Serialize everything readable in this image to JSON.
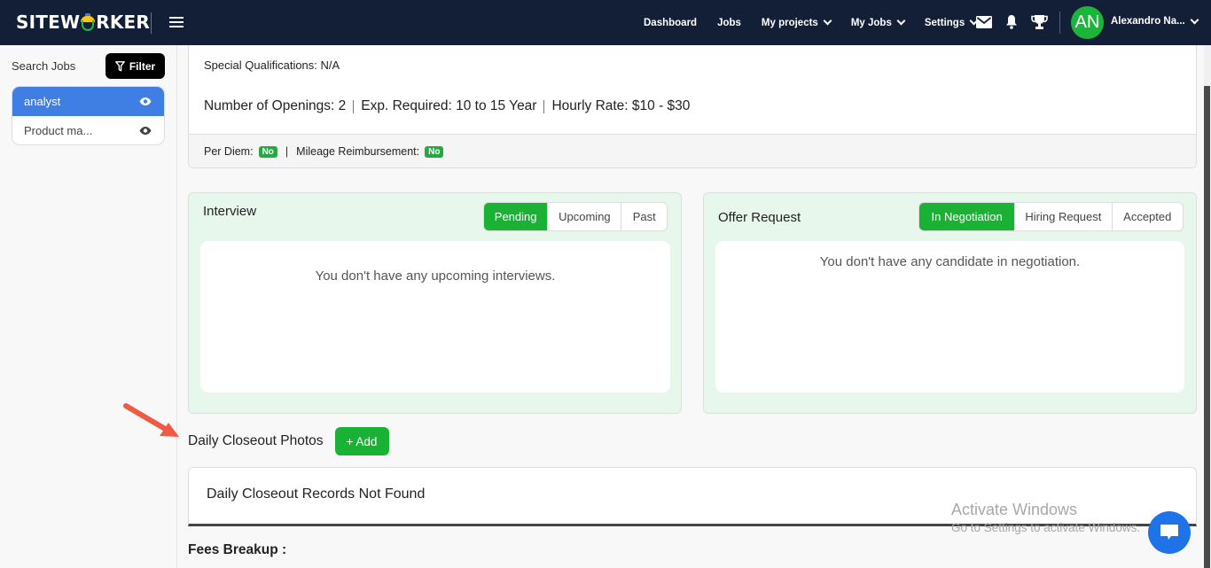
{
  "header": {
    "logo": "SITEWORKER",
    "logo_parts": {
      "before": "SITEW",
      "after": "RKER"
    },
    "nav": [
      {
        "label": "Dashboard",
        "has_dropdown": false
      },
      {
        "label": "Jobs",
        "has_dropdown": false
      },
      {
        "label": "My projects",
        "has_dropdown": true
      },
      {
        "label": "My Jobs",
        "has_dropdown": true
      },
      {
        "label": "Settings",
        "has_dropdown": true
      }
    ],
    "icons": [
      "mail-icon",
      "bell-icon",
      "trophy-icon"
    ],
    "user": {
      "initials": "AN",
      "name": "Alexandro Na...",
      "avatar_color": "#1cb53c"
    }
  },
  "sidebar": {
    "search_label": "Search Jobs",
    "filter_label": "Filter",
    "jobs": [
      {
        "title": "analyst",
        "active": true
      },
      {
        "title": "Product ma...",
        "active": false
      }
    ]
  },
  "details": {
    "special_label": "Special Qualifications:",
    "special_value": "N/A",
    "openings": "Number of Openings: 2",
    "experience": "Exp. Required: 10 to 15 Year",
    "rate": "Hourly Rate: $10 - $30",
    "per_diem_label": "Per Diem:",
    "per_diem_value": "No",
    "mileage_label": "Mileage Reimbursement:",
    "mileage_value": "No",
    "separator": "|"
  },
  "interview": {
    "title": "Interview",
    "tabs": [
      {
        "label": "Pending",
        "active": true
      },
      {
        "label": "Upcoming",
        "active": false
      },
      {
        "label": "Past",
        "active": false
      }
    ],
    "empty_message": "You don't have any upcoming interviews."
  },
  "offer": {
    "title": "Offer Request",
    "tabs": [
      {
        "label": "In Negotiation",
        "active": true
      },
      {
        "label": "Hiring Request",
        "active": false
      },
      {
        "label": "Accepted",
        "active": false
      }
    ],
    "empty_message": "You don't have any candidate in negotiation."
  },
  "daily_closeout": {
    "title": "Daily Closeout Photos",
    "add_label": "+ Add",
    "empty_message": "Daily Closeout Records Not Found"
  },
  "fees": {
    "title": "Fees Breakup :"
  },
  "watermark": {
    "line1": "Activate Windows",
    "line2": "Go to Settings to activate Windows."
  },
  "colors": {
    "topbar": "#131f36",
    "accent_green": "#19b234",
    "active_blue": "#3f7fe4",
    "panel_bg": "#e7f7ec",
    "chat_blue": "#1e73e8"
  }
}
